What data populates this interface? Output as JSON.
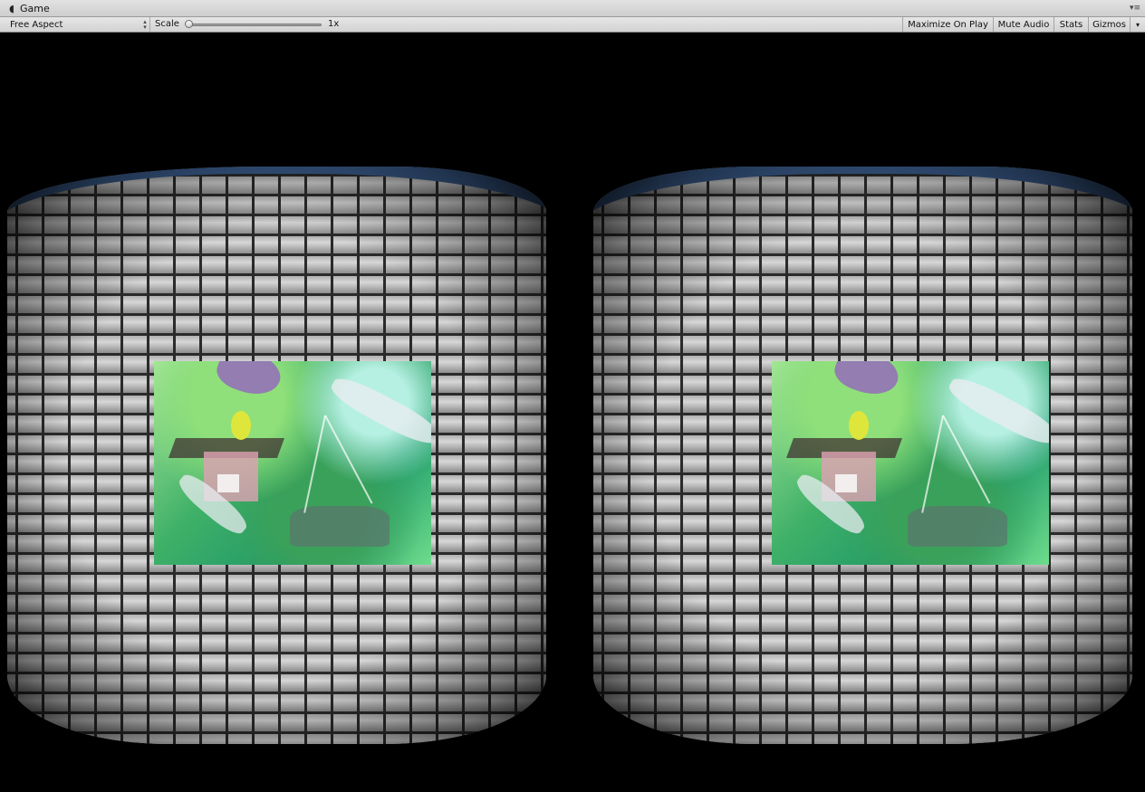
{
  "tab": {
    "icon": "pacman-game-icon",
    "title": "Game",
    "menu_icon": "panel-menu-icon"
  },
  "toolbar": {
    "aspect_label": "Free Aspect",
    "aspect_arrows_icon": "up-down-arrows-icon",
    "scale_label": "Scale",
    "scale_value": "1x",
    "scale_slider_position": 0,
    "maximize_label": "Maximize On Play",
    "mute_label": "Mute Audio",
    "stats_label": "Stats",
    "gizmos_label": "Gizmos",
    "gizmos_dropdown_icon": "dropdown-arrow-icon"
  },
  "viewport": {
    "mode": "stereo-vr-barrel-distortion",
    "background": "#000000",
    "sky_color": "#3b5e8f",
    "wall": "brick-wall",
    "picture": "anime-collage-texture"
  }
}
